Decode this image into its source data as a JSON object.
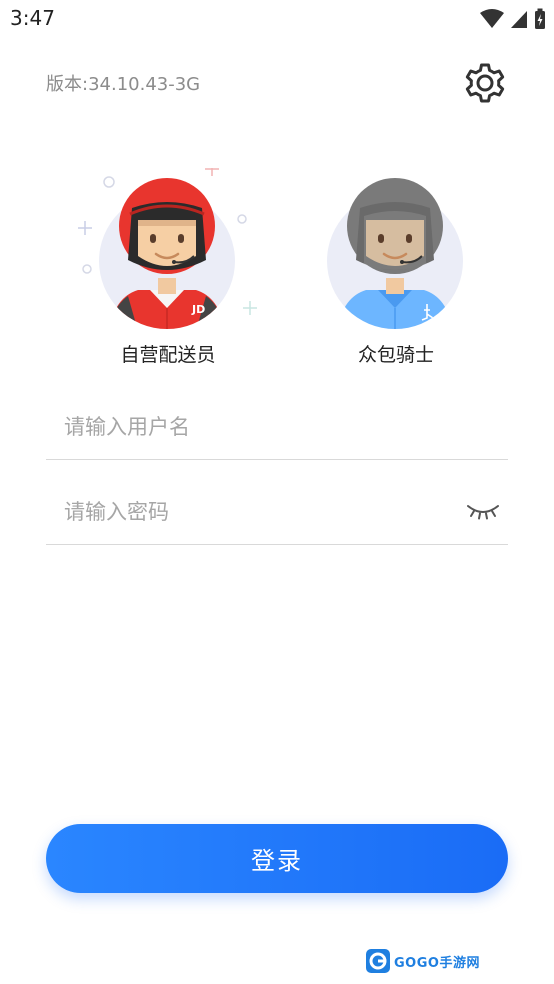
{
  "status_bar": {
    "time": "3:47"
  },
  "header": {
    "version_text": "版本:34.10.43-3G"
  },
  "roles": [
    {
      "label": "自营配送员",
      "badge": "JD",
      "selected": true
    },
    {
      "label": "众包骑士",
      "selected": false
    }
  ],
  "form": {
    "username_placeholder": "请输入用户名",
    "password_placeholder": "请输入密码",
    "username_value": "",
    "password_value": ""
  },
  "login": {
    "label": "登录"
  },
  "watermark": {
    "brand": "GOGO",
    "cn": "手游网"
  },
  "colors": {
    "primary": "#1a6cf6",
    "helmet_active": "#e8352e",
    "helmet_inactive": "#7a7a7a",
    "shirt_inactive": "#6db6ff"
  }
}
